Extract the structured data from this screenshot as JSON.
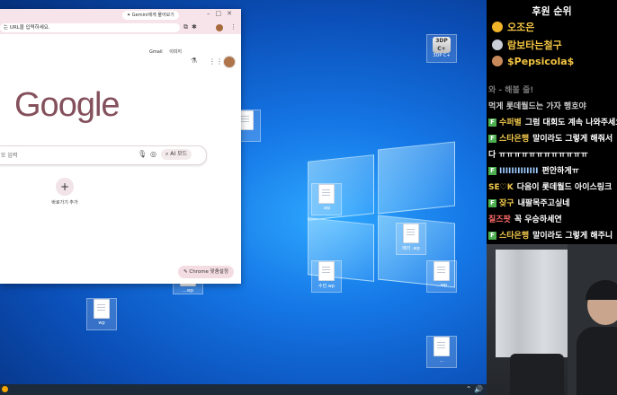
{
  "desktop": {
    "icons": [
      {
        "name": "app-3dp",
        "label": "3DP C+",
        "badge": "3DP C+"
      },
      {
        "name": "file-1",
        "label": ""
      },
      {
        "name": "file-2",
        "label": ".wp"
      },
      {
        "name": "file-3",
        "label": "메리 .wp"
      },
      {
        "name": "file-4",
        "label": "수민.wp"
      },
      {
        "name": "file-5",
        "label": "…wp"
      },
      {
        "name": "file-6",
        "label": "…wp"
      },
      {
        "name": "file-7",
        "label": "wp"
      },
      {
        "name": "file-8",
        "label": "…"
      }
    ]
  },
  "browser": {
    "gemini_pill": "Gemini에게 물어보기",
    "omnibox_placeholder": "는 URL을 입력하세요.",
    "gmail": "Gmail",
    "images": "이미지",
    "logo": "Google",
    "search_placeholder": "또 입력",
    "ai_mode": "AI 모드",
    "add_shortcut": "바로가기 추가",
    "customize": "Chrome 맞춤설정"
  },
  "panel": {
    "title": "후원 순위",
    "ranks": [
      {
        "name": "오조은",
        "medal_color": "#f0b429"
      },
      {
        "name": "람보타는철구",
        "medal_color": "#c9ced6"
      },
      {
        "name": "$Pepsicola$",
        "medal_color": "#c98a5b"
      }
    ],
    "chat": [
      {
        "badge": "",
        "nick": "",
        "text": "와 - 해볼 줄!",
        "faded": true
      },
      {
        "badge": "",
        "nick": "",
        "text": "먹게 롯데월드는 가자 행호야",
        "faded": true
      },
      {
        "badge": "F",
        "nick": "수퍼별",
        "text": "그럼 대회도 계속 나와주세요",
        "faded": false
      },
      {
        "badge": "F",
        "nick": "스타은행",
        "text": "말이라도 그렇게 해줘서",
        "faded": false
      },
      {
        "badge": "",
        "nick": "",
        "text": "다 ㅠㅠㅠㅠㅠㅠㅠㅠㅠㅠㅠㅠ",
        "faded": false
      },
      {
        "badge": "F",
        "nick": "IIIIIIIIIIIII",
        "text": "편안하게ㅠ",
        "faded": false
      },
      {
        "badge": "",
        "nick": "SE♡K",
        "text": "다음이 롯데월드 아이스링크",
        "faded": false
      },
      {
        "badge": "F",
        "nick": "잦구",
        "text": "내팔목주고싶네",
        "faded": false
      },
      {
        "badge": "",
        "nick": "칠즈팟",
        "text": "꼭 우승하세연",
        "faded": false,
        "red": true
      },
      {
        "badge": "F",
        "nick": "스타은행",
        "text": "말이라도 그렇게 해주니",
        "faded": false
      }
    ]
  },
  "taskbar": {
    "tray": "⌃ 🔊"
  }
}
